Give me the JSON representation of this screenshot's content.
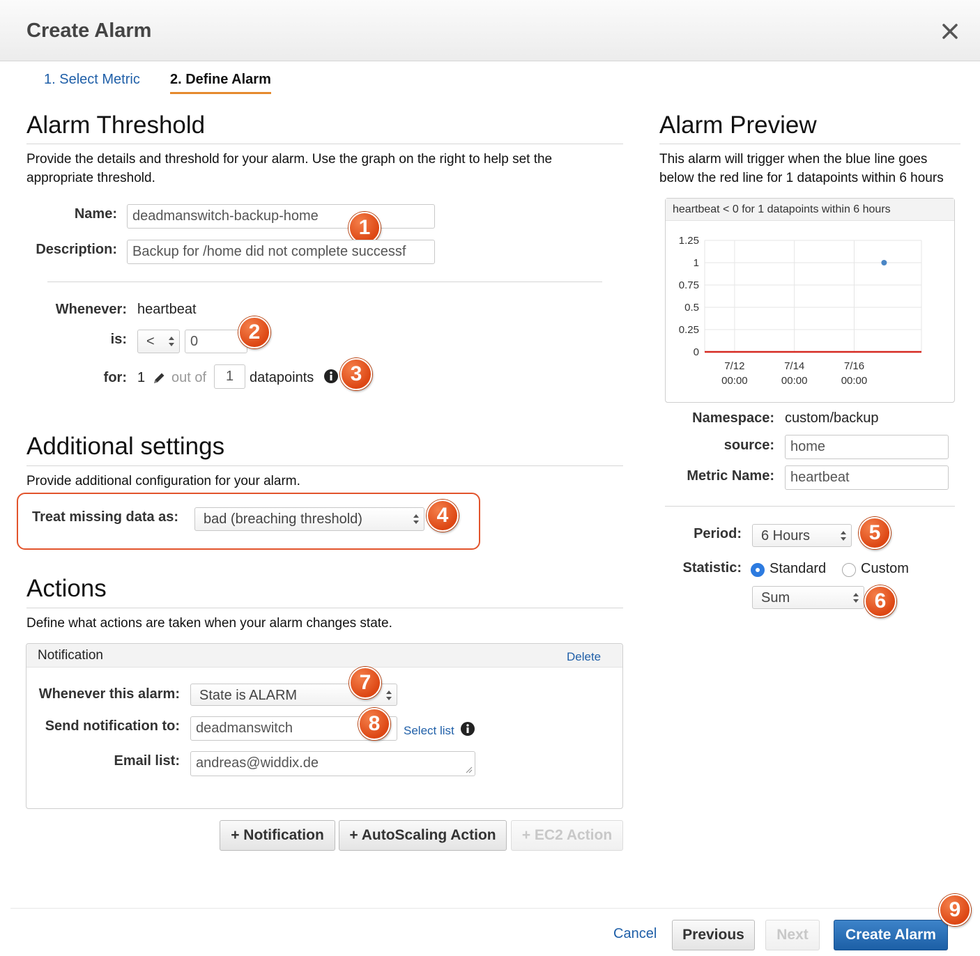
{
  "header": {
    "title": "Create Alarm"
  },
  "steps": [
    {
      "label": "1. Select Metric"
    },
    {
      "label": "2. Define Alarm"
    }
  ],
  "threshold": {
    "heading": "Alarm Threshold",
    "description": "Provide the details and threshold for your alarm. Use the graph on the right to help set the appropriate threshold.",
    "name_label": "Name:",
    "name_value": "deadmanswitch-backup-home",
    "description_label": "Description:",
    "description_value": "Backup for /home did not complete successf",
    "whenever_label": "Whenever:",
    "whenever_value": "heartbeat",
    "is_label": "is:",
    "operator": "<",
    "threshold_value": "0",
    "for_label": "for:",
    "for_value": "1",
    "out_of": "out of",
    "out_of_value": "1",
    "datapoints": "datapoints"
  },
  "additional": {
    "heading": "Additional settings",
    "description": "Provide additional configuration for your alarm.",
    "missing_label": "Treat missing data as:",
    "missing_value": "bad (breaching threshold)"
  },
  "actions": {
    "heading": "Actions",
    "description": "Define what actions are taken when your alarm changes state.",
    "panel_title": "Notification",
    "delete": "Delete",
    "whenever_label": "Whenever this alarm:",
    "whenever_value": "State is ALARM",
    "send_label": "Send notification to:",
    "send_value": "deadmanswitch",
    "select_list": "Select list",
    "email_label": "Email list:",
    "email_value": "andreas@widdix.de",
    "add_notification": "+ Notification",
    "add_autoscaling": "+ AutoScaling Action",
    "add_ec2": "+ EC2 Action"
  },
  "preview": {
    "heading": "Alarm Preview",
    "description": "This alarm will trigger when the blue line goes below the red line for 1 datapoints within 6 hours",
    "namespace_label": "Namespace:",
    "namespace_value": "custom/backup",
    "source_label": "source:",
    "source_value": "home",
    "metric_label": "Metric Name:",
    "metric_value": "heartbeat",
    "period_label": "Period:",
    "period_value": "6 Hours",
    "statistic_label": "Statistic:",
    "standard": "Standard",
    "custom": "Custom",
    "statistic_value": "Sum"
  },
  "chart_data": {
    "type": "line",
    "title": "heartbeat < 0 for 1 datapoints within 6 hours",
    "yticks": [
      "1.25",
      "1",
      "0.75",
      "0.5",
      "0.25",
      "0"
    ],
    "ylim": [
      0,
      1.25
    ],
    "xticks": [
      {
        "day": "7/12",
        "time": "00:00"
      },
      {
        "day": "7/14",
        "time": "00:00"
      },
      {
        "day": "7/16",
        "time": "00:00"
      }
    ],
    "grid": true,
    "series": [
      {
        "color": "#4a86c5",
        "points": [
          {
            "x": "7/17 00:00",
            "y": 1
          }
        ]
      }
    ],
    "threshold": {
      "value": 0,
      "color": "#d62a22"
    }
  },
  "footer": {
    "cancel": "Cancel",
    "previous": "Previous",
    "next": "Next",
    "create": "Create Alarm"
  },
  "badges": [
    "1",
    "2",
    "3",
    "4",
    "5",
    "6",
    "7",
    "8",
    "9"
  ],
  "colors": {
    "accent": "#1f5fa8",
    "badge": "#e45a1f",
    "highlight": "#e2542c",
    "tab_underline": "#e58a2e"
  }
}
